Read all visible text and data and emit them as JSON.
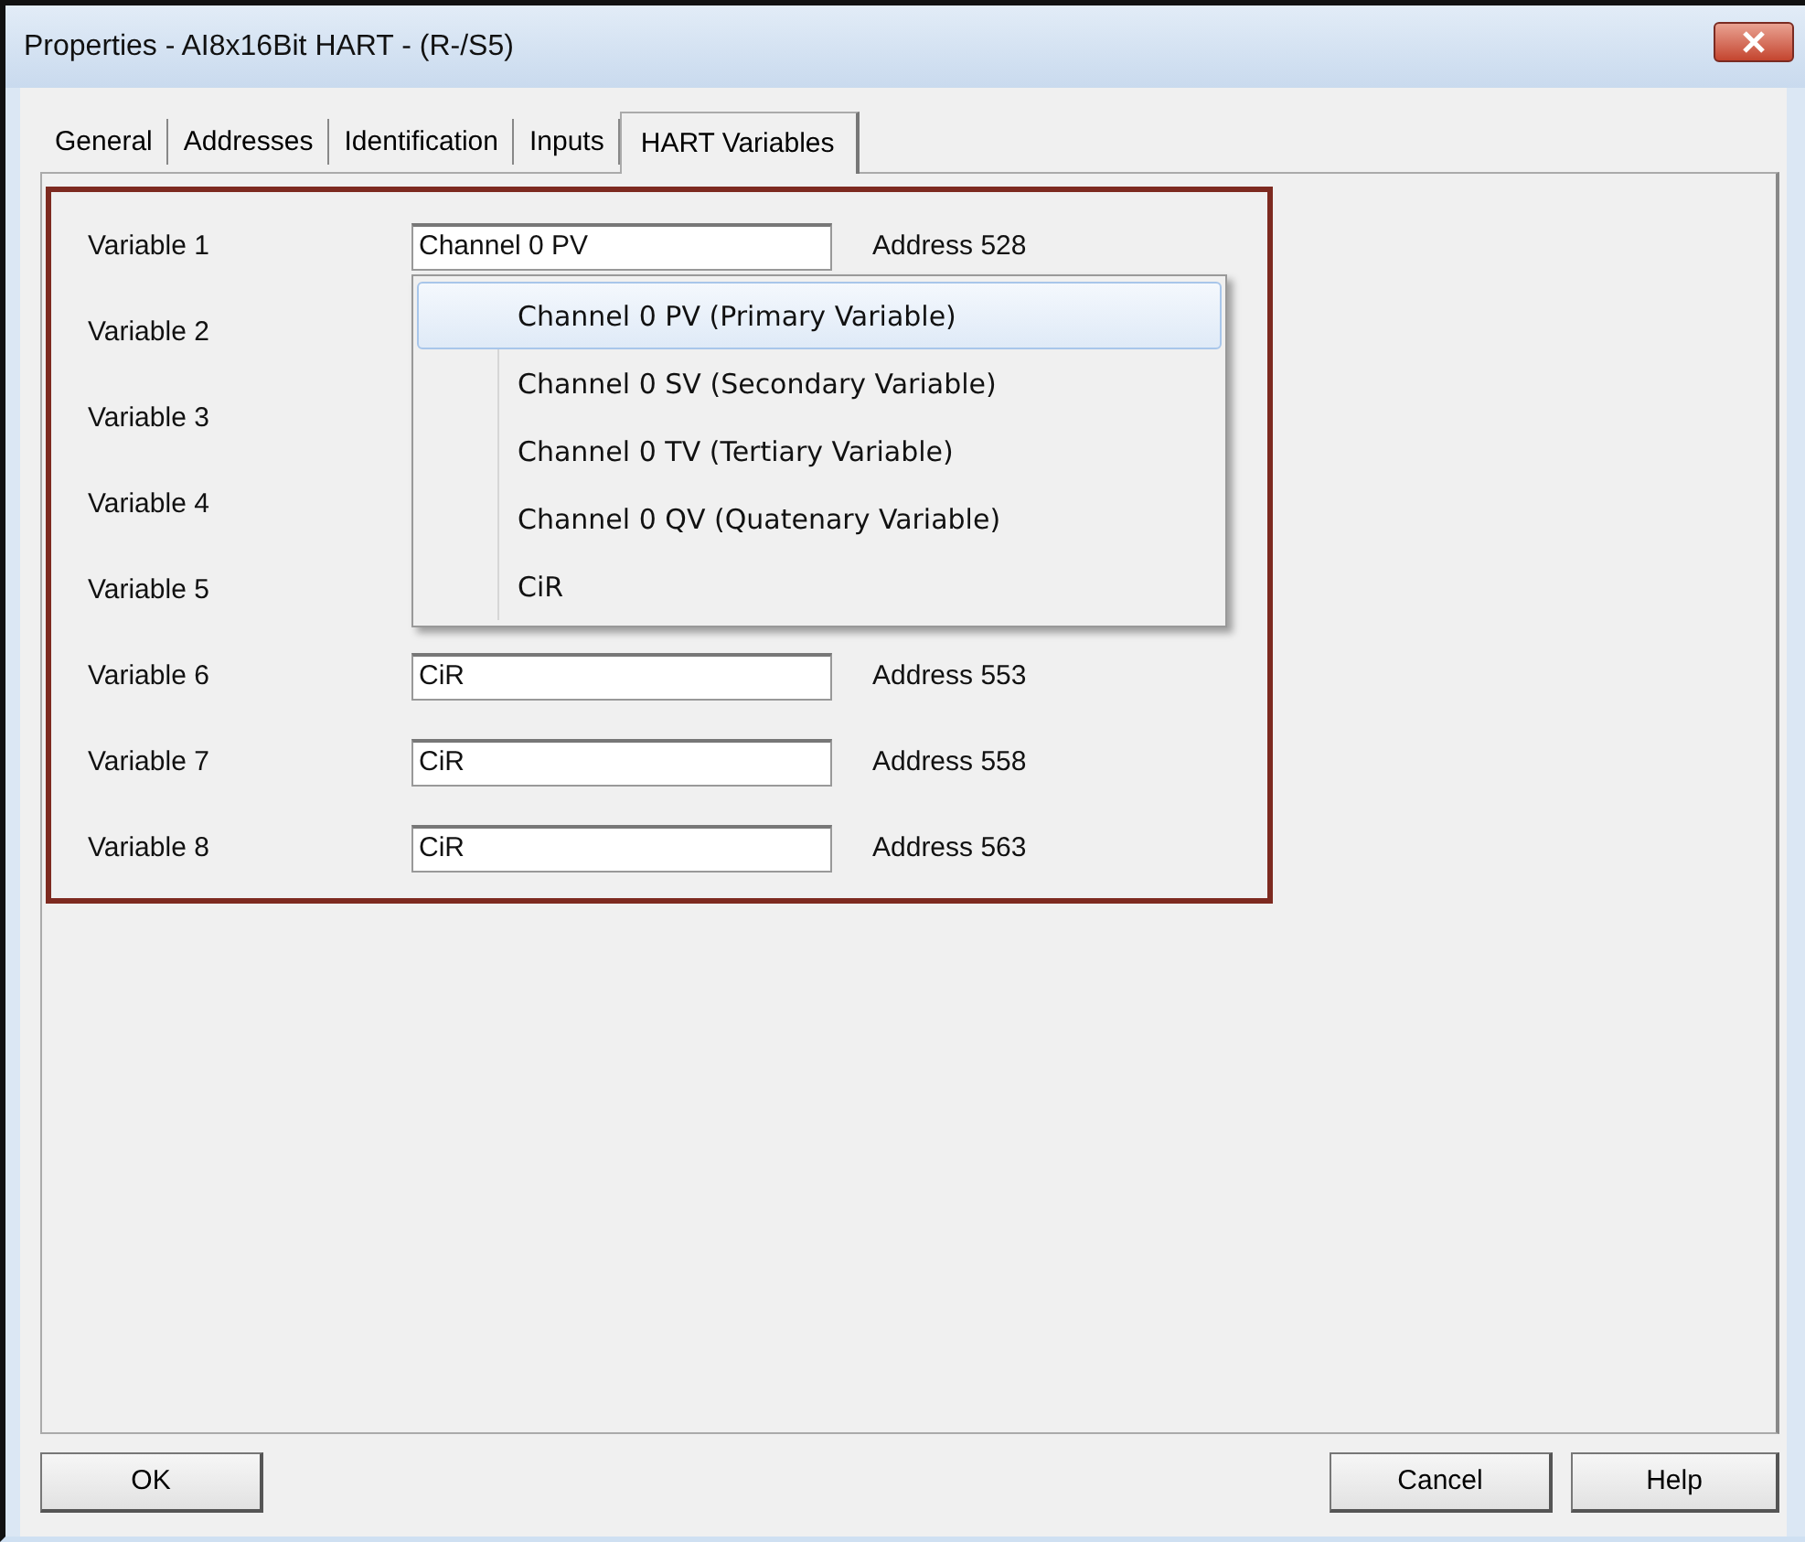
{
  "window": {
    "title": "Properties - AI8x16Bit HART - (R-/S5)"
  },
  "tabs": [
    {
      "label": "General",
      "selected": false
    },
    {
      "label": "Addresses",
      "selected": false
    },
    {
      "label": "Identification",
      "selected": false
    },
    {
      "label": "Inputs",
      "selected": false
    },
    {
      "label": "HART Variables",
      "selected": true
    }
  ],
  "variables": [
    {
      "label": "Variable 1",
      "value": "Channel 0 PV",
      "address": "Address 528"
    },
    {
      "label": "Variable 2"
    },
    {
      "label": "Variable 3"
    },
    {
      "label": "Variable 4"
    },
    {
      "label": "Variable 5"
    },
    {
      "label": "Variable 6",
      "value": "CiR",
      "address": "Address 553"
    },
    {
      "label": "Variable 7",
      "value": "CiR",
      "address": "Address 558"
    },
    {
      "label": "Variable 8",
      "value": "CiR",
      "address": "Address 563"
    }
  ],
  "dropdown": [
    {
      "label": "Channel 0 PV (Primary Variable)",
      "selected": true
    },
    {
      "label": "Channel 0 SV (Secondary Variable)",
      "selected": false
    },
    {
      "label": "Channel 0 TV (Tertiary Variable)",
      "selected": false
    },
    {
      "label": "Channel 0 QV (Quatenary Variable)",
      "selected": false
    },
    {
      "label": "CiR",
      "selected": false
    }
  ],
  "buttons": {
    "ok": "OK",
    "cancel": "Cancel",
    "help": "Help"
  }
}
